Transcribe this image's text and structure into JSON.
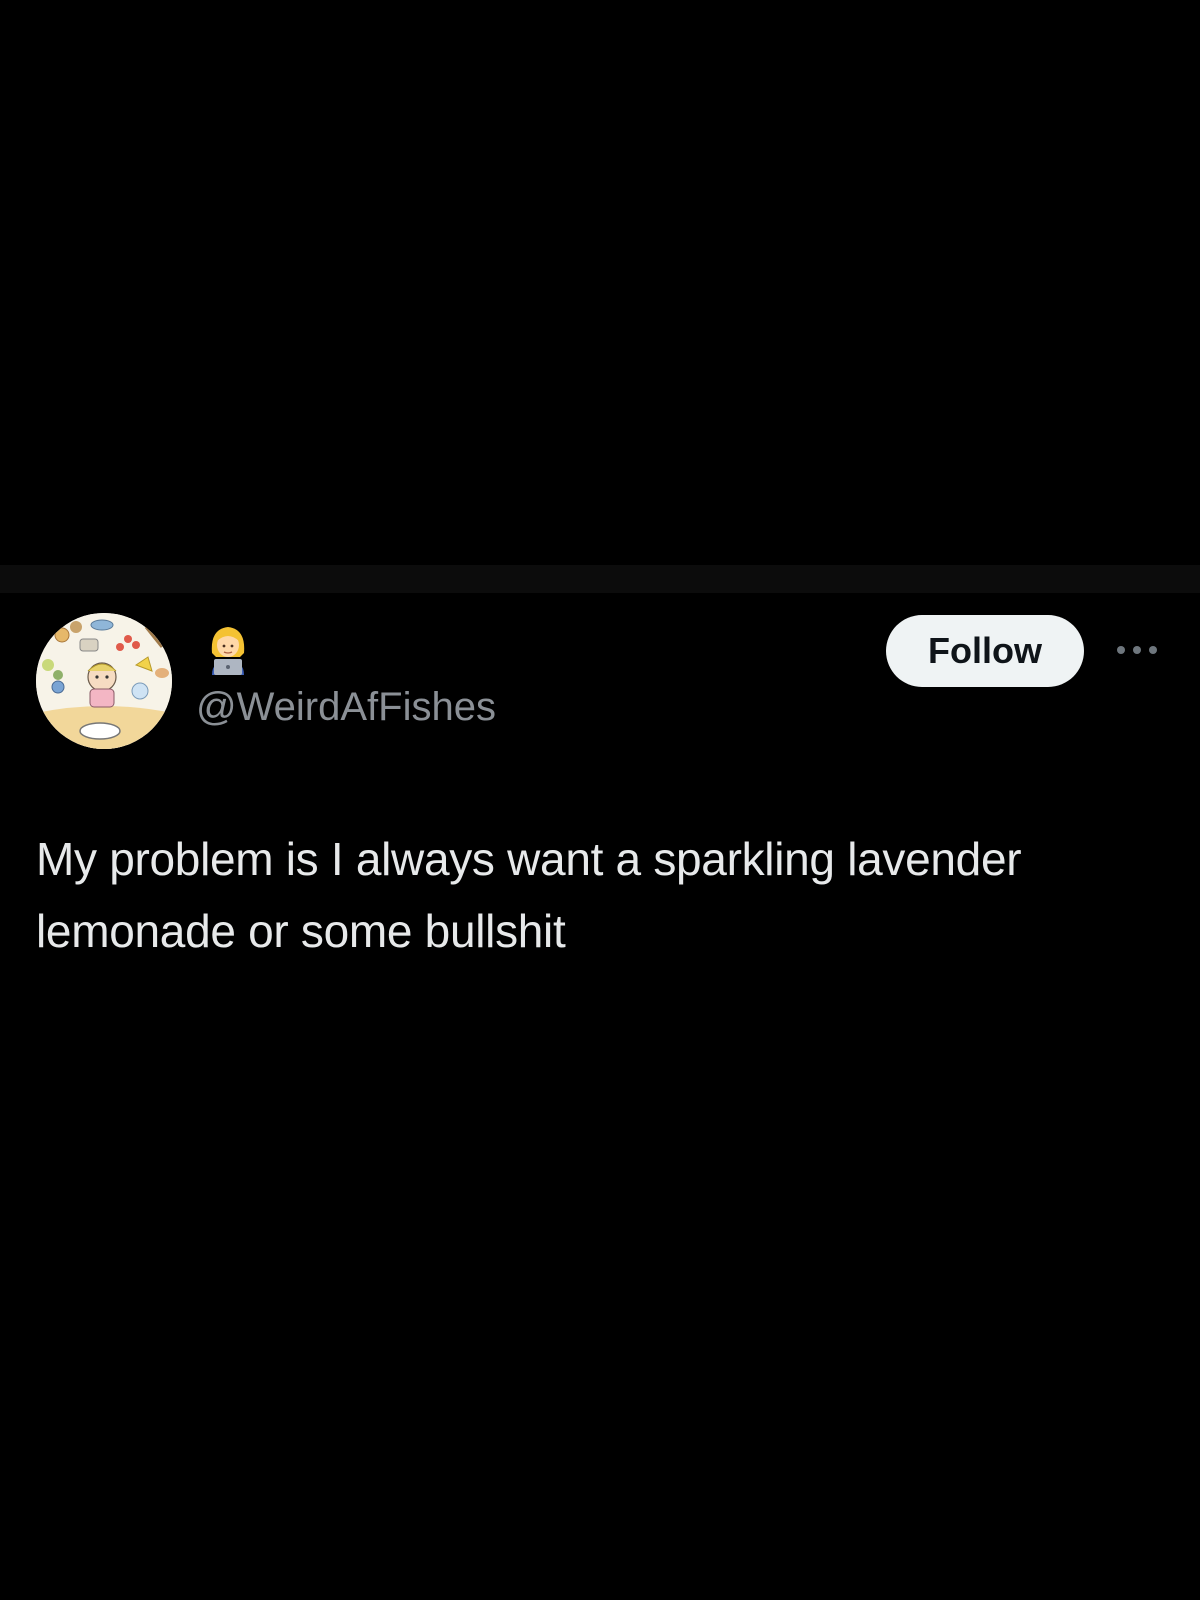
{
  "post": {
    "handle": "@WeirdAfFishes",
    "display_name_icon": "woman-technologist-emoji-icon",
    "follow_label": "Follow",
    "more_icon": "more-options-icon",
    "text": "My problem is I always want a sparkling lavender lemonade or some bullshit"
  },
  "colors": {
    "background": "#000000",
    "text_primary": "#e7e9ea",
    "text_secondary": "#8b9096",
    "follow_bg": "#eff3f4",
    "follow_text": "#0f1419"
  }
}
